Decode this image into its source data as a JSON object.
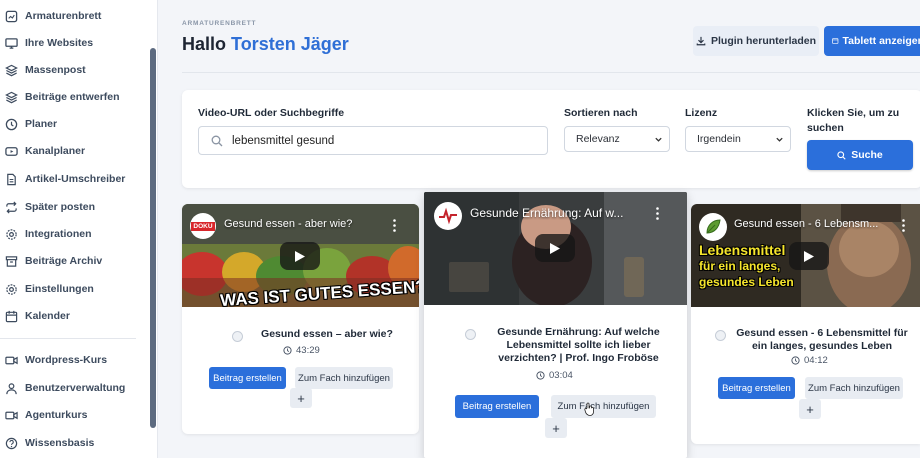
{
  "sidebar": {
    "items": [
      {
        "label": "Armaturenbrett",
        "icon": "dashboard-icon"
      },
      {
        "label": "Ihre Websites",
        "icon": "monitor-icon"
      },
      {
        "label": "Massenpost",
        "icon": "layers-icon"
      },
      {
        "label": "Beiträge entwerfen",
        "icon": "layers-icon"
      },
      {
        "label": "Planer",
        "icon": "clock-icon"
      },
      {
        "label": "Kanalplaner",
        "icon": "video-icon"
      },
      {
        "label": "Artikel-Umschreiber",
        "icon": "document-icon"
      },
      {
        "label": "Später posten",
        "icon": "repeat-icon"
      },
      {
        "label": "Integrationen",
        "icon": "gear-icon"
      },
      {
        "label": "Beiträge Archiv",
        "icon": "archive-icon"
      },
      {
        "label": "Einstellungen",
        "icon": "settings-icon"
      },
      {
        "label": "Kalender",
        "icon": "calendar-icon"
      },
      {
        "label": "Wordpress-Kurs",
        "icon": "camera-icon"
      },
      {
        "label": "Benutzerverwaltung",
        "icon": "user-icon"
      },
      {
        "label": "Agenturkurs",
        "icon": "camera-icon"
      },
      {
        "label": "Wissensbasis",
        "icon": "help-icon"
      }
    ]
  },
  "header": {
    "eyebrow": "ARMATURENBRETT",
    "greeting": "Hallo",
    "user_name": "Torsten Jäger",
    "plugin_button": "Plugin herunterladen",
    "tablet_button": "Tablett anzeigen"
  },
  "search": {
    "query_label": "Video-URL oder Suchbegriffe",
    "query_value": "lebensmittel gesund",
    "sort_label": "Sortieren nach",
    "sort_value": "Relevanz",
    "license_label": "Lizenz",
    "license_value": "Irgendein",
    "click_label": "Klicken Sie, um zu suchen",
    "search_button": "Suche"
  },
  "results": [
    {
      "thumb_title": "Gesund essen - aber wie?",
      "channel_badge": "DOKU",
      "overlay_text": "WAS IST GUTES ESSEN?",
      "title": "Gesund essen – aber wie?",
      "duration": "43:29",
      "create_label": "Beitrag erstellen",
      "fach_label": "Zum Fach hinzufügen",
      "plus_label": "+"
    },
    {
      "thumb_title": "Gesunde Ernährung: Auf w...",
      "title": "Gesunde Ernährung: Auf welche Lebensmittel sollte ich lieber verzichten? | Prof. Ingo Froböse",
      "duration": "03:04",
      "create_label": "Beitrag erstellen",
      "fach_label": "Zum Fach hinzufügen",
      "plus_label": "+"
    },
    {
      "thumb_title": "Gesund essen - 6 Lebensm...",
      "overlay_line1": "Lebensmittel",
      "overlay_line2": "für ein langes,",
      "overlay_line3": "gesundes Leben",
      "title": "Gesund essen - 6 Lebensmittel für ein langes, gesundes Leben",
      "duration": "04:12",
      "create_label": "Beitrag erstellen",
      "fach_label": "Zum Fach hinzufügen",
      "plus_label": "+"
    }
  ],
  "colors": {
    "accent": "#2b6fdb",
    "sidebar_text": "#3d4b5e",
    "page_bg": "#f3f5f9"
  }
}
